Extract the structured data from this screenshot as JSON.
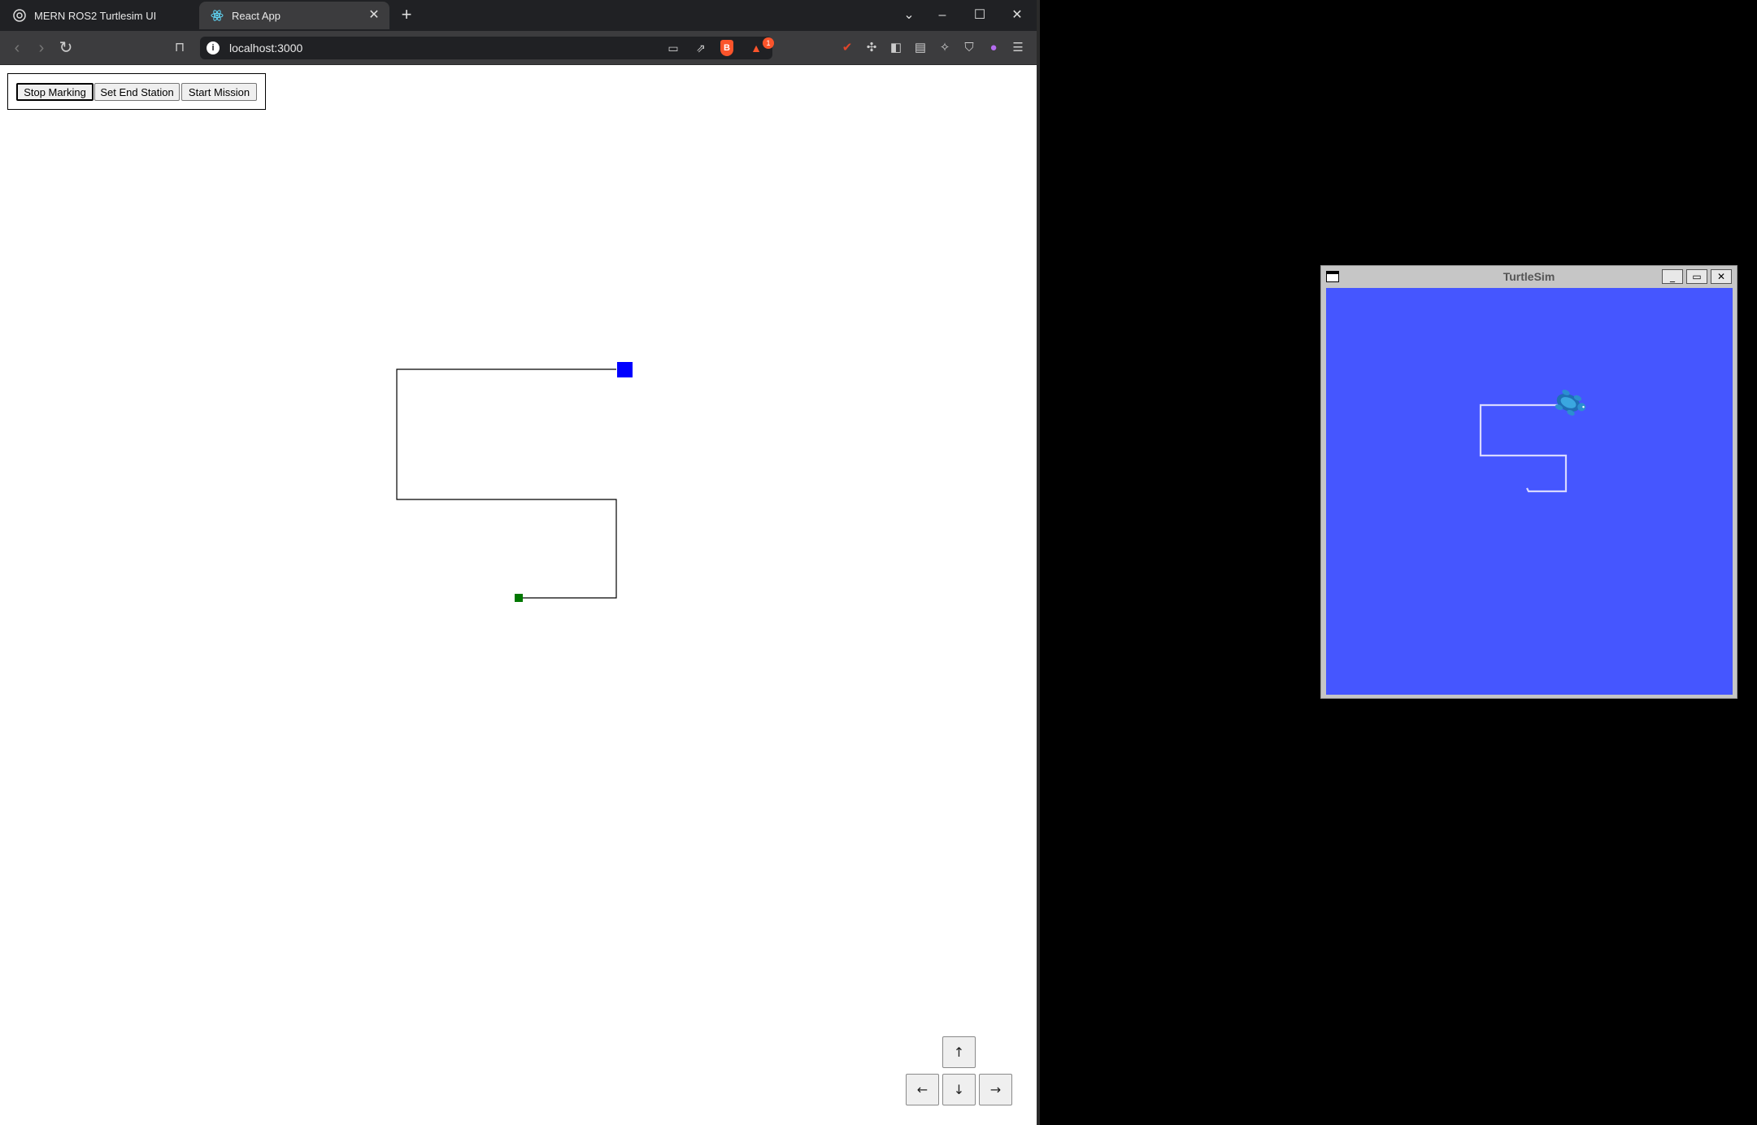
{
  "browser": {
    "tabs": [
      {
        "title": "MERN ROS2 Turtlesim UI",
        "active": false
      },
      {
        "title": "React App",
        "active": true
      }
    ],
    "url": "localhost:3000",
    "rewards_badge": "1",
    "colors": {
      "chrome_bg": "#202124",
      "toolbar_bg": "#3c3c3e",
      "brave_orange": "#fb542b"
    }
  },
  "page": {
    "buttons": {
      "stop_marking": "Stop Marking",
      "set_end_station": "Set End Station",
      "start_mission": "Start Mission"
    },
    "arrows": {
      "up": "↑",
      "left": "←",
      "down": "↓",
      "right": "→"
    },
    "path": {
      "start_marker_color": "#007700",
      "end_marker_color": "#0000ff",
      "line_color": "#000000"
    }
  },
  "turtlesim": {
    "title": "TurtleSim",
    "background_color": "#4556ff",
    "trail_color": "#d8d8ff",
    "turtle_icon": "turtle-icon"
  }
}
